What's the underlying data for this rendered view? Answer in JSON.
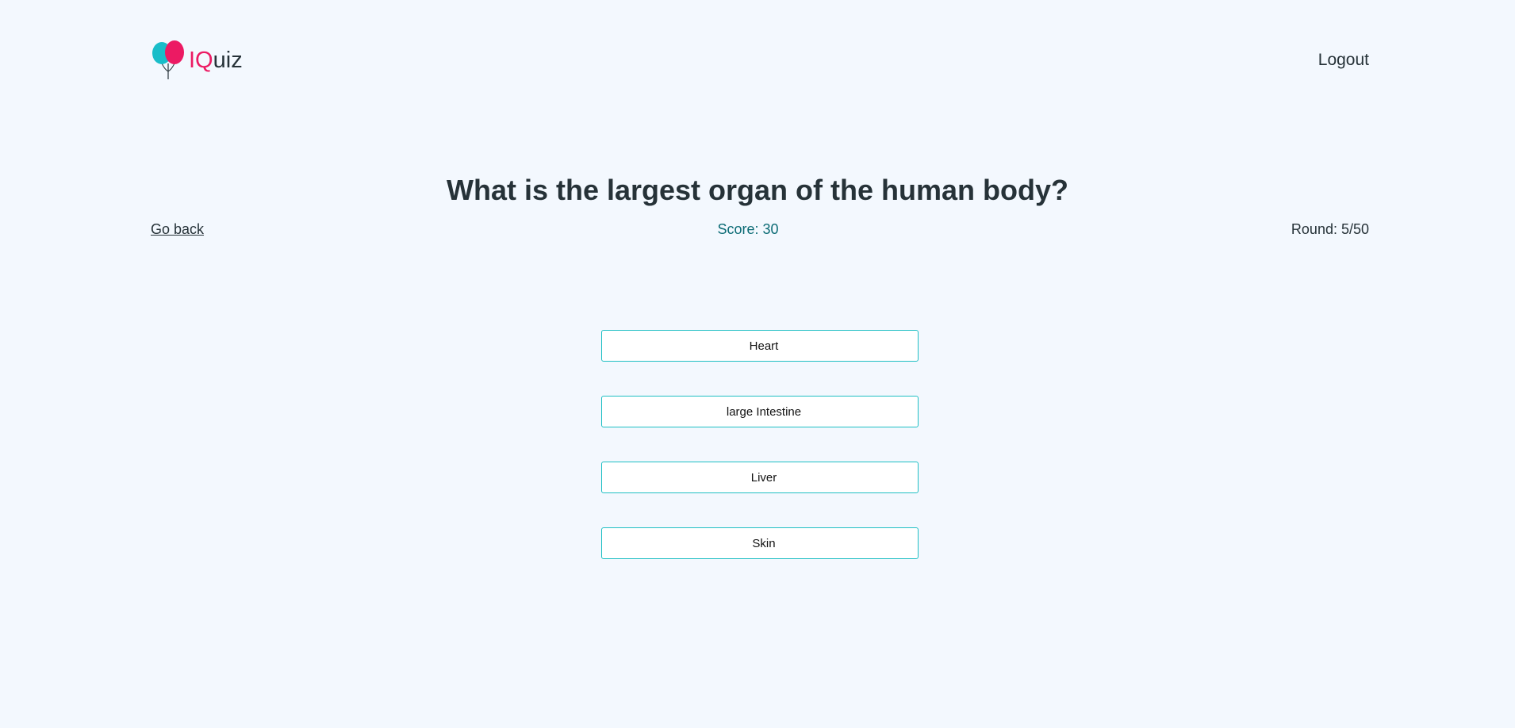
{
  "header": {
    "brand_prefix": "IQ",
    "brand_suffix": "uiz",
    "logout_label": "Logout"
  },
  "quiz": {
    "question": "What is the largest organ of the human body?",
    "go_back_label": "Go back",
    "score_text": "Score: 30",
    "round_text": "Round: 5/50",
    "answers": [
      {
        "label": "Heart"
      },
      {
        "label": "large Intestine"
      },
      {
        "label": "Liver"
      },
      {
        "label": "Skin"
      }
    ]
  },
  "colors": {
    "background": "#f3f8fe",
    "accent_pink": "#ec1a63",
    "accent_teal": "#1fbfc4",
    "score_text": "#0b6b75",
    "text": "#263238"
  },
  "icons": {
    "logo": "balloons-icon"
  }
}
